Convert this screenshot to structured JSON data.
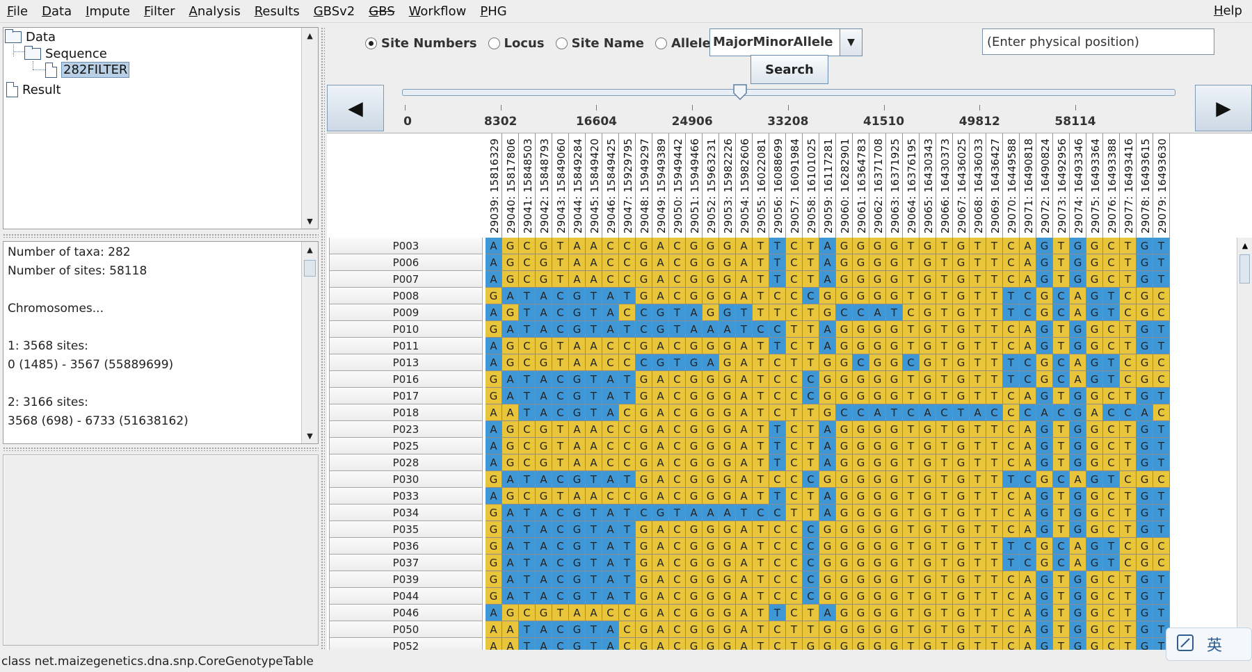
{
  "menu": {
    "items": [
      "File",
      "Data",
      "Impute",
      "Filter",
      "Analysis",
      "Results",
      "GBSv2",
      "GBS",
      "Workflow",
      "PHG"
    ],
    "help": "Help"
  },
  "tree": {
    "root": "Data",
    "sequence": "Sequence",
    "selected_item": "282FILTER",
    "result": "Result"
  },
  "info": {
    "text": "Number of taxa: 282\nNumber of sites: 58118\n\nChromosomes...\n\n1: 3568 sites:\n0 (1485) - 3567 (55889699)\n\n2: 3166 sites:\n3568 (698) - 6733 (51638162)"
  },
  "controls": {
    "radios": [
      {
        "label": "Site Numbers",
        "checked": true
      },
      {
        "label": "Locus",
        "checked": false
      },
      {
        "label": "Site Name",
        "checked": false
      },
      {
        "label": "Alleles",
        "checked": false
      }
    ],
    "combo_value": "MajorMinorAllele",
    "position_placeholder": "(Enter physical position)",
    "search_label": "Search",
    "slider_ticks": [
      "0",
      "8302",
      "16604",
      "24906",
      "33208",
      "41510",
      "49812",
      "58114"
    ],
    "slider_value": 29039
  },
  "table": {
    "columns": [
      "29039: 15816329",
      "29040: 15817806",
      "29041: 15848503",
      "29042: 15848793",
      "29043: 15849060",
      "29044: 15849284",
      "29045: 15849420",
      "29046: 15849425",
      "29047: 15929795",
      "29048: 15949297",
      "29049: 15949389",
      "29050: 15949442",
      "29051: 15949466",
      "29052: 15963231",
      "29053: 15982226",
      "29054: 15982606",
      "29055: 16022081",
      "29056: 16088699",
      "29057: 16091984",
      "29058: 16101025",
      "29059: 16117281",
      "29060: 16282901",
      "29061: 16364783",
      "29062: 16371708",
      "29063: 16371925",
      "29064: 16376195",
      "29065: 16430343",
      "29066: 16430373",
      "29067: 16436025",
      "29068: 16436033",
      "29069: 16436427",
      "29070: 16449588",
      "29071: 16490818",
      "29072: 16490824",
      "29073: 16492956",
      "29074: 16493346",
      "29075: 16493364",
      "29076: 16493388",
      "29077: 16493416",
      "29078: 16493615",
      "29079: 16493630"
    ],
    "rows": [
      {
        "taxon": "P003",
        "alleles": "AGCGTAACCGACGGGATTCTAGGGGTGTGTTCAGTGGCTGT",
        "mask": "10000000000000000100100000000000010100011"
      },
      {
        "taxon": "P006",
        "alleles": "AGCGTAACCGACGGGATTCTAGGGGTGTGTTCAGTGGCTGT",
        "mask": "10000000000000000100100000000000010100011"
      },
      {
        "taxon": "P007",
        "alleles": "AGCGTAACCGACGGGATTCTAGGGGTGTGTTCAGTGGCTGT",
        "mask": "10000000000000000100100000000000010100011"
      },
      {
        "taxon": "P008",
        "alleles": "GATACGTATGACGGGATCCCGGGGGTGTGTTTCGCAGTCGC",
        "mask": "01111111100000000001000000000001101011000"
      },
      {
        "taxon": "P009",
        "alleles": "AGTACGTACCGTAGGTTTCTGCCATCGTGTTTCGCAGTCGC",
        "mask": "10111111011110110000011110000001101011000"
      },
      {
        "taxon": "P010",
        "alleles": "GATACGTATCGTAAATCCTTAGGGGTGTGTTCAGTGGCTGT",
        "mask": "01111111111111111100100000000000010100011"
      },
      {
        "taxon": "P011",
        "alleles": "AGCGTAACCGACGGGATTCTAGGGGTGTGTTCAGTGGCTGT",
        "mask": "10000000000000000100100000000000010100011"
      },
      {
        "taxon": "P013",
        "alleles": "AGCGTAACCCGTGAGATCTTGGCGGCGTGTTTCGCAGTCGC",
        "mask": "10000000011111000000001001000001101011000"
      },
      {
        "taxon": "P016",
        "alleles": "GATACGTATGACGGGATCCCGGGGGTGTGTTTCGCAGTCGC",
        "mask": "01111111100000000001000000000001101011000"
      },
      {
        "taxon": "P017",
        "alleles": "GATACGTATGACGGGATCCCGGGGGTGTGTTCAGTGGCTGT",
        "mask": "01111111100000000001000000000000010100011"
      },
      {
        "taxon": "P018",
        "alleles": "AATACGTACGACGGGATCTTGCCATCACTACCCACGACCAC",
        "mask": "00111111000000000000011111111110111101110"
      },
      {
        "taxon": "P023",
        "alleles": "AGCGTAACCGACGGGATTCTAGGGGTGTGTTCAGTGGCTGT",
        "mask": "10000000000000000100100000000000010100011"
      },
      {
        "taxon": "P025",
        "alleles": "AGCGTAACCGACGGGATTCTAGGGGTGTGTTCAGTGGCTGT",
        "mask": "10000000000000000100100000000000010100011"
      },
      {
        "taxon": "P028",
        "alleles": "AGCGTAACCGACGGGATTCTAGGGGTGTGTTCAGTGGCTGT",
        "mask": "10000000000000000100100000000000010100011"
      },
      {
        "taxon": "P030",
        "alleles": "GATACGTATGACGGGATCCCGGGGGTGTGTTTCGCAGTCGC",
        "mask": "01111111100000000001000000000001101011000"
      },
      {
        "taxon": "P033",
        "alleles": "AGCGTAACCGACGGGATTCTAGGGGTGTGTTCAGTGGCTGT",
        "mask": "10000000000000000100100000000000010100011"
      },
      {
        "taxon": "P034",
        "alleles": "GATACGTATCGTAAATCCTTAGGGGTGTGTTCAGTGGCTGT",
        "mask": "01111111111111111100100000000000010100011"
      },
      {
        "taxon": "P035",
        "alleles": "GATACGTATGACGGGATCCCGGGGGTGTGTTCAGTGGCTGT",
        "mask": "01111111100000000001000000000000010100011"
      },
      {
        "taxon": "P036",
        "alleles": "GATACGTATGACGGGATCCCGGGGGTGTGTTTCGCAGTCGC",
        "mask": "01111111100000000001000000000001101011000"
      },
      {
        "taxon": "P037",
        "alleles": "GATACGTATGACGGGATCCCGGGGGTGTGTTTCGCAGTCGC",
        "mask": "01111111100000000001000000000001101011000"
      },
      {
        "taxon": "P039",
        "alleles": "GATACGTATGACGGGATCCCGGGGGTGTGTTCAGTGGCTGT",
        "mask": "01111111100000000001000000000000010100011"
      },
      {
        "taxon": "P044",
        "alleles": "GATACGTATGACGGGATCCCGGGGGTGTGTTCAGTGGCTGT",
        "mask": "01111111100000000001000000000000010100011"
      },
      {
        "taxon": "P046",
        "alleles": "AGCGTAACCGACGGGATTCTAGGGGTGTGTTCAGTGGCTGT",
        "mask": "10000000000000000100100000000000010100011"
      },
      {
        "taxon": "P050",
        "alleles": "AATACGTACGACGGGATCTTGGGGGTGTGTTCAGTGGCTGT",
        "mask": "00111111000000000000000000000000010100011"
      },
      {
        "taxon": "P052",
        "alleles": "AATACGTACGACGGGATCTGGGGGGTGTGTTCAGTGGCTGT",
        "mask": "00111111000000000000000000000000010100011"
      }
    ]
  },
  "status": {
    "text": "class net.maizegenetics.dna.snp.CoreGenotypeTable"
  },
  "ime": {
    "label": "英"
  },
  "colors": {
    "major": "#e8c53a",
    "minor": "#3f97d6"
  }
}
